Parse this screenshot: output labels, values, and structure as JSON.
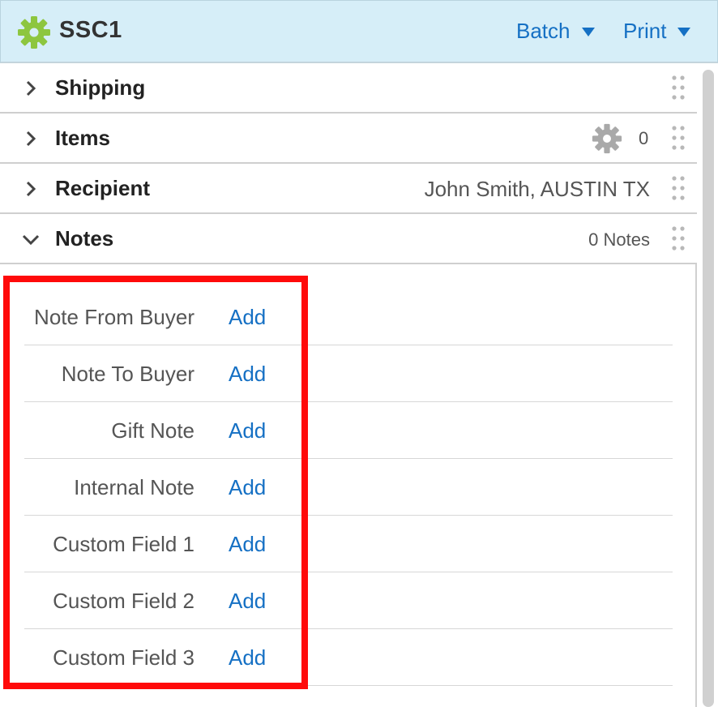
{
  "header": {
    "title": "SSC1",
    "icon": "gear-icon",
    "accent_color": "#8dc63f",
    "menus": [
      {
        "label": "Batch"
      },
      {
        "label": "Print"
      }
    ]
  },
  "sections": {
    "shipping": {
      "label": "Shipping",
      "expanded": false
    },
    "items": {
      "label": "Items",
      "count": "0",
      "expanded": false
    },
    "recipient": {
      "label": "Recipient",
      "summary": "John Smith, AUSTIN TX",
      "expanded": false
    },
    "notes": {
      "label": "Notes",
      "summary": "0 Notes",
      "expanded": true
    }
  },
  "notes": {
    "add_label": "Add",
    "rows": [
      {
        "label": "Note From Buyer"
      },
      {
        "label": "Note To Buyer"
      },
      {
        "label": "Gift Note"
      },
      {
        "label": "Internal Note"
      },
      {
        "label": "Custom Field 1"
      },
      {
        "label": "Custom Field 2"
      },
      {
        "label": "Custom Field 3"
      }
    ]
  },
  "colors": {
    "link": "#1570c4",
    "highlight": "#ff0a0a",
    "header_bg": "#d6eef8"
  }
}
